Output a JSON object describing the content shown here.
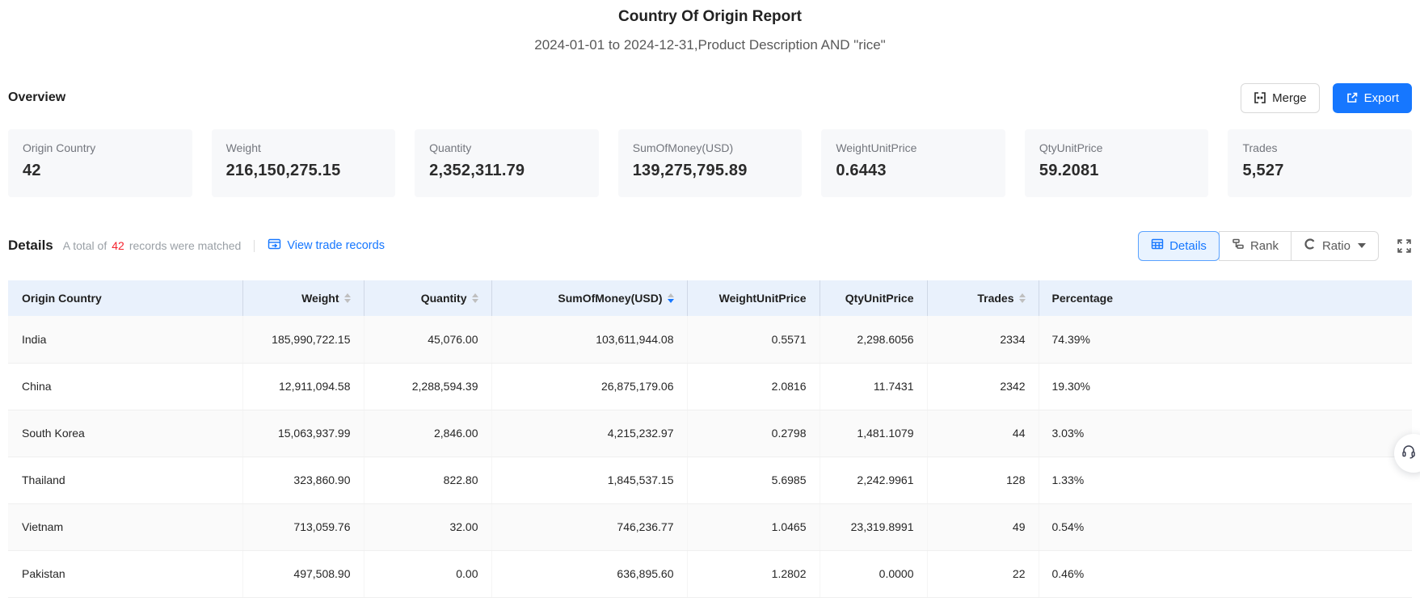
{
  "report": {
    "title": "Country Of Origin Report",
    "subtitle": "2024-01-01 to 2024-12-31,Product Description AND \"rice\""
  },
  "toolbar": {
    "section_title": "Overview",
    "merge_label": "Merge",
    "export_label": "Export"
  },
  "overview": {
    "cards": [
      {
        "label": "Origin Country",
        "value": "42"
      },
      {
        "label": "Weight",
        "value": "216,150,275.15"
      },
      {
        "label": "Quantity",
        "value": "2,352,311.79"
      },
      {
        "label": "SumOfMoney(USD)",
        "value": "139,275,795.89"
      },
      {
        "label": "WeightUnitPrice",
        "value": "0.6443"
      },
      {
        "label": "QtyUnitPrice",
        "value": "59.2081"
      },
      {
        "label": "Trades",
        "value": "5,527"
      }
    ]
  },
  "details": {
    "section_title": "Details",
    "matched_prefix": "A total of",
    "matched_count": "42",
    "matched_suffix": "records were matched",
    "view_trade_records_label": "View trade records",
    "tabs": [
      {
        "label": "Details",
        "active": true
      },
      {
        "label": "Rank",
        "active": false
      },
      {
        "label": "Ratio",
        "active": false,
        "has_dropdown": true
      }
    ]
  },
  "table": {
    "columns": [
      {
        "label": "Origin Country",
        "sortable": false,
        "align": "left"
      },
      {
        "label": "Weight",
        "sortable": true,
        "sort": "none"
      },
      {
        "label": "Quantity",
        "sortable": true,
        "sort": "none"
      },
      {
        "label": "SumOfMoney(USD)",
        "sortable": true,
        "sort": "desc"
      },
      {
        "label": "WeightUnitPrice",
        "sortable": false
      },
      {
        "label": "QtyUnitPrice",
        "sortable": false
      },
      {
        "label": "Trades",
        "sortable": true,
        "sort": "none"
      },
      {
        "label": "Percentage",
        "sortable": false,
        "align": "left"
      }
    ],
    "rows": [
      [
        "India",
        "185,990,722.15",
        "45,076.00",
        "103,611,944.08",
        "0.5571",
        "2,298.6056",
        "2334",
        "74.39%"
      ],
      [
        "China",
        "12,911,094.58",
        "2,288,594.39",
        "26,875,179.06",
        "2.0816",
        "11.7431",
        "2342",
        "19.30%"
      ],
      [
        "South Korea",
        "15,063,937.99",
        "2,846.00",
        "4,215,232.97",
        "0.2798",
        "1,481.1079",
        "44",
        "3.03%"
      ],
      [
        "Thailand",
        "323,860.90",
        "822.80",
        "1,845,537.15",
        "5.6985",
        "2,242.9961",
        "128",
        "1.33%"
      ],
      [
        "Vietnam",
        "713,059.76",
        "32.00",
        "746,236.77",
        "1.0465",
        "23,319.8991",
        "49",
        "0.54%"
      ],
      [
        "Pakistan",
        "497,508.90",
        "0.00",
        "636,895.60",
        "1.2802",
        "0.0000",
        "22",
        "0.46%"
      ]
    ]
  },
  "colors": {
    "accent_blue": "#1677ff",
    "count_red": "#f5222d",
    "table_header_bg": "#e9f1fc",
    "zebra_row_bg": "#fafafa",
    "card_bg": "#f7f8fa"
  }
}
